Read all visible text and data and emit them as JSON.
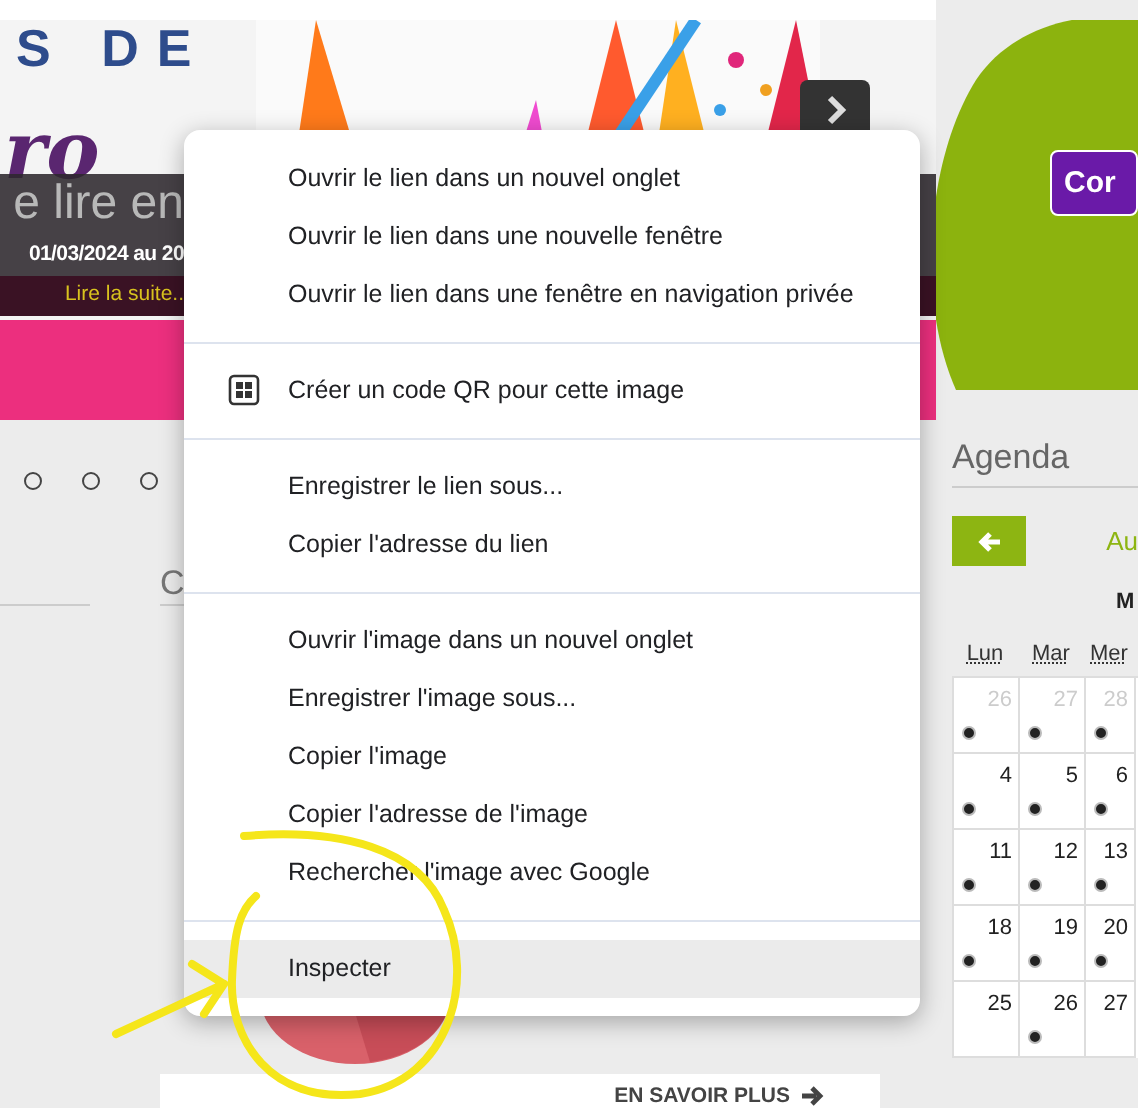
{
  "header": {
    "title": "S DE",
    "script": "ro"
  },
  "slider": {
    "caption": "e lire en",
    "dates": "01/03/2024 au 20",
    "link": "Lire la suite..",
    "dots": [
      {
        "selected": false
      },
      {
        "selected": false
      },
      {
        "selected": false
      }
    ]
  },
  "section_heading": "C",
  "context_menu": {
    "groups": [
      {
        "items": [
          {
            "label": "Ouvrir le lien dans un nouvel onglet",
            "kind": "plain",
            "selected": false
          },
          {
            "label": "Ouvrir le lien dans une nouvelle fenêtre",
            "kind": "plain",
            "selected": false
          },
          {
            "label": "Ouvrir le lien dans une fenêtre en navigation privée",
            "kind": "plain",
            "selected": false
          }
        ]
      },
      {
        "items": [
          {
            "label": "Créer un code QR pour cette image",
            "kind": "qr",
            "selected": false
          }
        ]
      },
      {
        "items": [
          {
            "label": "Enregistrer le lien sous...",
            "kind": "plain",
            "selected": false
          },
          {
            "label": "Copier l'adresse du lien",
            "kind": "plain",
            "selected": false
          }
        ]
      },
      {
        "items": [
          {
            "label": "Ouvrir l'image dans un nouvel onglet",
            "kind": "plain",
            "selected": false
          },
          {
            "label": "Enregistrer l'image sous...",
            "kind": "plain",
            "selected": false
          },
          {
            "label": "Copier l'image",
            "kind": "plain",
            "selected": false
          },
          {
            "label": "Copier l'adresse de l'image",
            "kind": "plain",
            "selected": false
          },
          {
            "label": "Rechercher l'image avec Google",
            "kind": "plain",
            "selected": false
          }
        ]
      },
      {
        "items": [
          {
            "label": "Inspecter",
            "kind": "plain",
            "selected": true
          }
        ]
      }
    ]
  },
  "promo": {
    "button": "Cor"
  },
  "agenda": {
    "title": "Agenda",
    "nav_label": "Au",
    "month": "M",
    "weekdays": [
      "Lun",
      "Mar",
      "Mer"
    ],
    "weeks": [
      [
        {
          "day": "26",
          "muted": true,
          "dot": true
        },
        {
          "day": "27",
          "muted": true,
          "dot": true
        },
        {
          "day": "28",
          "muted": true,
          "dot": true
        }
      ],
      [
        {
          "day": "4",
          "muted": false,
          "dot": true
        },
        {
          "day": "5",
          "muted": false,
          "dot": true
        },
        {
          "day": "6",
          "muted": false,
          "dot": true
        }
      ],
      [
        {
          "day": "11",
          "muted": false,
          "dot": true
        },
        {
          "day": "12",
          "muted": false,
          "dot": true
        },
        {
          "day": "13",
          "muted": false,
          "dot": true
        }
      ],
      [
        {
          "day": "18",
          "muted": false,
          "dot": true
        },
        {
          "day": "19",
          "muted": false,
          "dot": true
        },
        {
          "day": "20",
          "muted": false,
          "dot": true
        }
      ],
      [
        {
          "day": "25",
          "muted": false,
          "dot": false
        },
        {
          "day": "26",
          "muted": false,
          "dot": true
        },
        {
          "day": "27",
          "muted": false,
          "dot": false
        }
      ]
    ]
  },
  "more_link": "EN SAVOIR PLUS"
}
